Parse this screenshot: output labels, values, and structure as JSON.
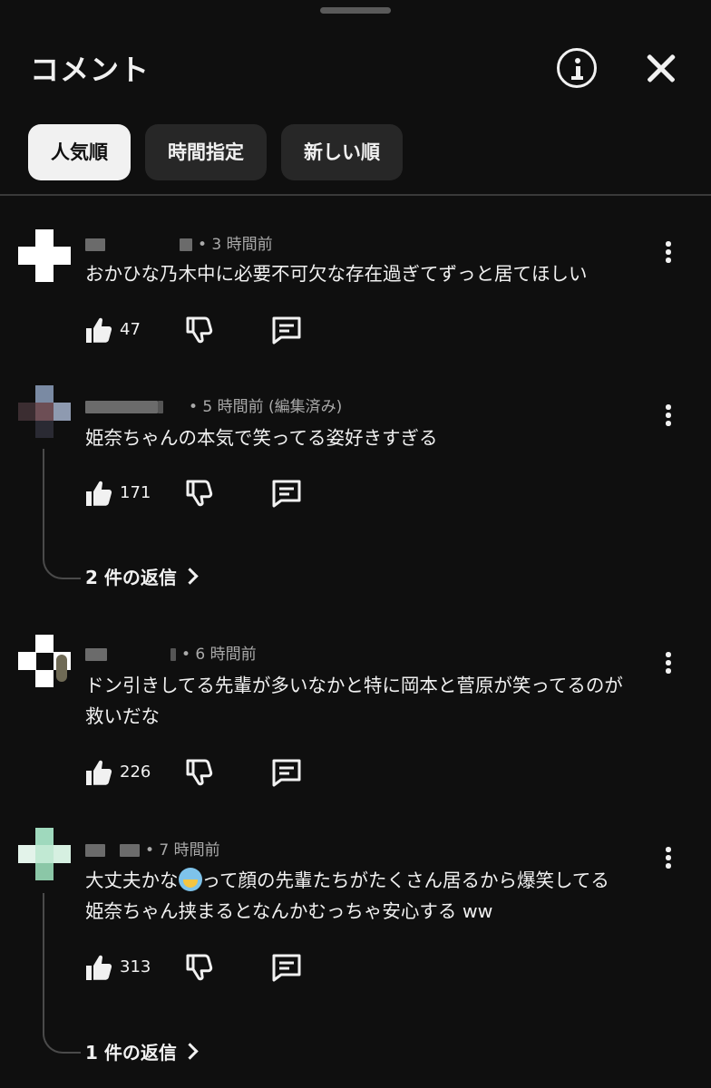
{
  "header": {
    "title": "コメント",
    "info_icon": "info-circle-icon",
    "close_icon": "close-icon"
  },
  "filters": [
    {
      "label": "人気順",
      "active": true
    },
    {
      "label": "時間指定",
      "active": false
    },
    {
      "label": "新しい順",
      "active": false
    }
  ],
  "comments": [
    {
      "time": "• 3 時間前",
      "text": "おかひな乃木中に必要不可欠な存在過ぎてずっと居てほしい",
      "likes": "47"
    },
    {
      "time": "• 5 時間前 (編集済み)",
      "text": "姫奈ちゃんの本気で笑ってる姿好きすぎる",
      "likes": "171",
      "replies": "2 件の返信"
    },
    {
      "time": "• 6 時間前",
      "text_line1": "ドン引きしてる先輩が多いなかと特に岡本と菅原が笑ってるのが",
      "text_line2": "救いだな",
      "likes": "226"
    },
    {
      "time": "• 7 時間前",
      "text_before_emoji": "大丈夫かな",
      "emoji": "anxious-face-emoji",
      "text_after_emoji": "って顔の先輩たちがたくさん居るから爆笑してる",
      "text_line2": "姫奈ちゃん挟まるとなんかむっちゃ安心する ww",
      "likes": "313",
      "replies": "1 件の返信"
    }
  ],
  "icons": {
    "like": "thumbs-up-icon",
    "dislike": "thumbs-down-icon",
    "reply": "reply-comment-icon",
    "more": "more-vertical-icon"
  },
  "colors": {
    "background": "#0f0f0f",
    "text": "#f1f1f1",
    "secondary_text": "#aaaaaa",
    "chip_inactive": "#272727",
    "chip_active": "#f1f1f1"
  }
}
